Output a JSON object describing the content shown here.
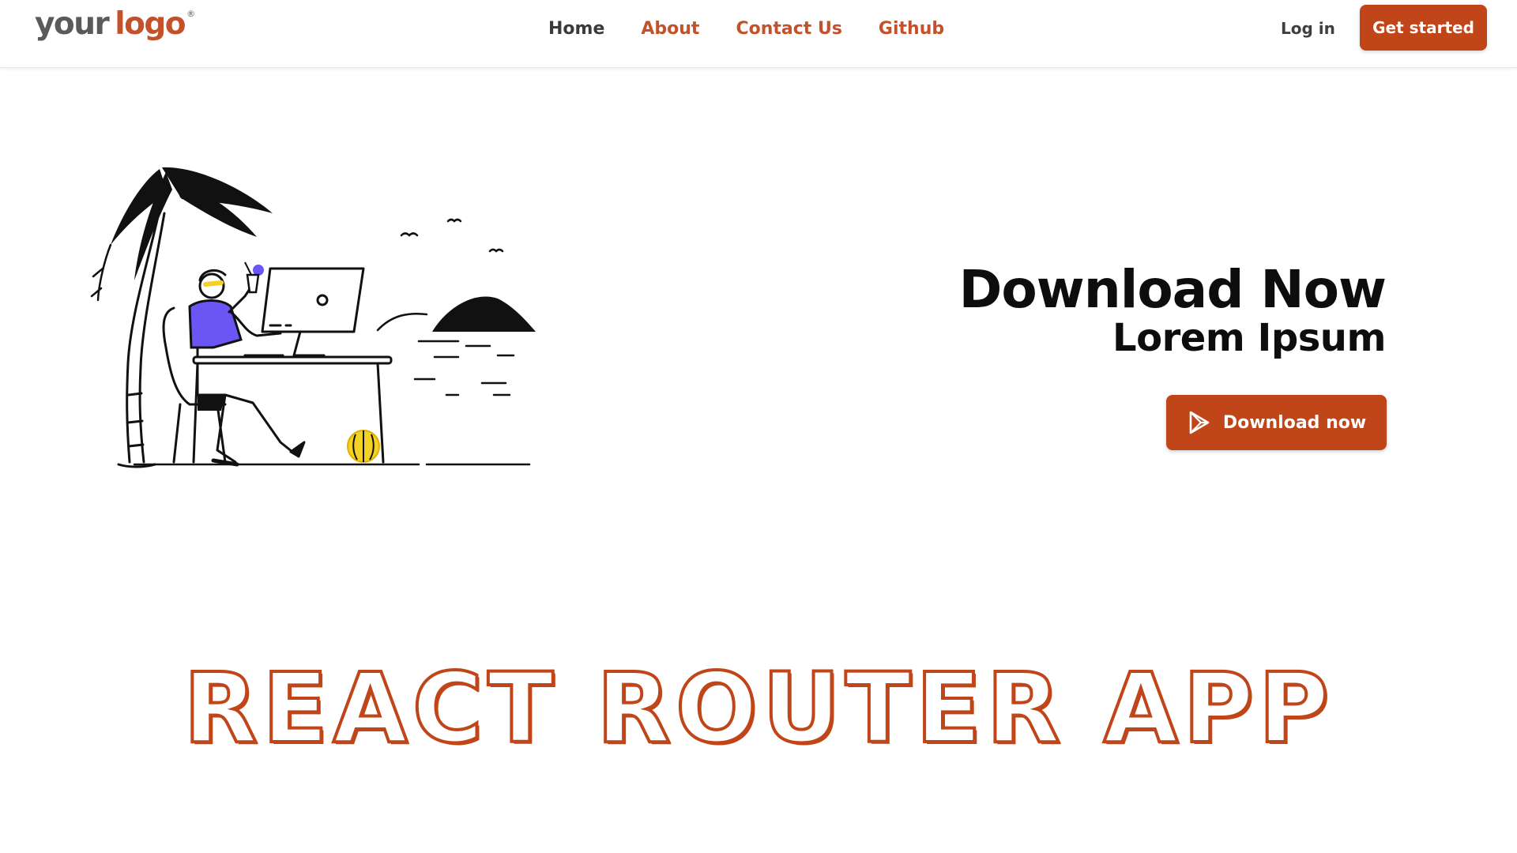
{
  "header": {
    "logo": {
      "part1": "your",
      "part2": "logo",
      "mark": "®"
    },
    "nav": [
      {
        "label": "Home"
      },
      {
        "label": "About"
      },
      {
        "label": "Contact Us"
      },
      {
        "label": "Github"
      }
    ],
    "login_label": "Log in",
    "cta_label": "Get started"
  },
  "hero": {
    "title": "Download Now",
    "subtitle": "Lorem Ipsum",
    "button_label": "Download now",
    "button_icon": "play-store-icon"
  },
  "footer_title": "REACT ROUTER APP",
  "colors": {
    "accent": "#c04518",
    "logo_gray": "#5a5a5a",
    "text_dark": "#0d0d0d",
    "illustration_shirt": "#6b55f5",
    "illustration_ball": "#f4d125"
  }
}
